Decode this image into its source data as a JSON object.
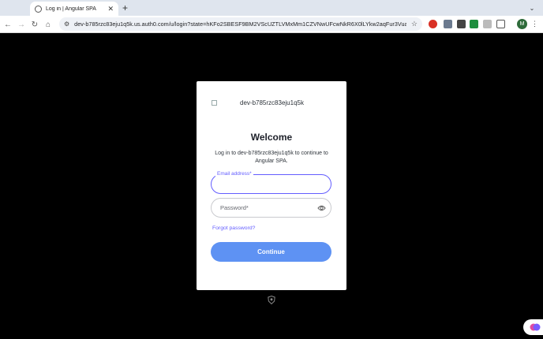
{
  "browser": {
    "tab": {
      "title": "Log in | Angular SPA",
      "close_icon": "close-icon"
    },
    "new_tab_label": "+",
    "tab_menu_icon": "chevron-down-icon",
    "url": "dev-b785rzc83eju1q5k.us.auth0.com/u/login?state=hKFo2SBESF9BM2VScUZTLVMxMm1CZVNwUFcwNkR6X0lLYkw2aqFur3VuaXZl...",
    "profile_initial": "M"
  },
  "card": {
    "logo_alt": "dev-b785rzc83eju1q5k",
    "title": "Welcome",
    "description": "Log in to dev-b785rzc83eju1q5k to continue to Angular SPA.",
    "email_label": "Email address*",
    "email_value": "",
    "password_placeholder": "Password*",
    "forgot_label": "Forgot password?",
    "continue_label": "Continue"
  },
  "colors": {
    "accent": "#635dff",
    "button": "#5e92f3",
    "background": "#000000"
  }
}
